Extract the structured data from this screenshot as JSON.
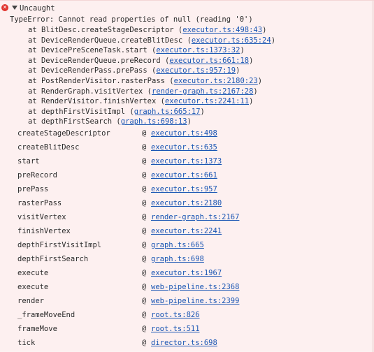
{
  "header": {
    "label": "Uncaught",
    "error_icon": "x-circle-icon",
    "toggle_icon": "triangle-down-icon"
  },
  "error_message": "TypeError: Cannot read properties of null (reading '0')",
  "trace": [
    {
      "prefix": "at BlitDesc.createStageDescriptor (",
      "link": "executor.ts:498:43",
      "suffix": ")"
    },
    {
      "prefix": "at DeviceRenderQueue.createBlitDesc (",
      "link": "executor.ts:635:24",
      "suffix": ")"
    },
    {
      "prefix": "at DevicePreSceneTask.start (",
      "link": "executor.ts:1373:32",
      "suffix": ")"
    },
    {
      "prefix": "at DeviceRenderQueue.preRecord (",
      "link": "executor.ts:661:18",
      "suffix": ")"
    },
    {
      "prefix": "at DeviceRenderPass.prePass (",
      "link": "executor.ts:957:19",
      "suffix": ")"
    },
    {
      "prefix": "at PostRenderVisitor.rasterPass (",
      "link": "executor.ts:2180:23",
      "suffix": ")"
    },
    {
      "prefix": "at RenderGraph.visitVertex (",
      "link": "render-graph.ts:2167:28",
      "suffix": ")"
    },
    {
      "prefix": "at RenderVisitor.finishVertex (",
      "link": "executor.ts:2241:11",
      "suffix": ")"
    },
    {
      "prefix": "at depthFirstVisitImpl (",
      "link": "graph.ts:665:17",
      "suffix": ")"
    },
    {
      "prefix": "at depthFirstSearch (",
      "link": "graph.ts:698:13",
      "suffix": ")"
    }
  ],
  "stack": [
    {
      "fn": "createStageDescriptor",
      "at": "@",
      "src": "executor.ts:498"
    },
    {
      "fn": "createBlitDesc",
      "at": "@",
      "src": "executor.ts:635"
    },
    {
      "fn": "start",
      "at": "@",
      "src": "executor.ts:1373"
    },
    {
      "fn": "preRecord",
      "at": "@",
      "src": "executor.ts:661"
    },
    {
      "fn": "prePass",
      "at": "@",
      "src": "executor.ts:957"
    },
    {
      "fn": "rasterPass",
      "at": "@",
      "src": "executor.ts:2180"
    },
    {
      "fn": "visitVertex",
      "at": "@",
      "src": "render-graph.ts:2167"
    },
    {
      "fn": "finishVertex",
      "at": "@",
      "src": "executor.ts:2241"
    },
    {
      "fn": "depthFirstVisitImpl",
      "at": "@",
      "src": "graph.ts:665"
    },
    {
      "fn": "depthFirstSearch",
      "at": "@",
      "src": "graph.ts:698"
    },
    {
      "fn": "execute",
      "at": "@",
      "src": "executor.ts:1967"
    },
    {
      "fn": "execute",
      "at": "@",
      "src": "web-pipeline.ts:2368"
    },
    {
      "fn": "render",
      "at": "@",
      "src": "web-pipeline.ts:2399"
    },
    {
      "fn": "_frameMoveEnd",
      "at": "@",
      "src": "root.ts:826"
    },
    {
      "fn": "frameMove",
      "at": "@",
      "src": "root.ts:511"
    },
    {
      "fn": "tick",
      "at": "@",
      "src": "director.ts:698"
    }
  ],
  "colors": {
    "background": "#fdf0f0",
    "error_red": "#e0332d",
    "link": "#1a56b4",
    "text": "#2b2b2b"
  }
}
